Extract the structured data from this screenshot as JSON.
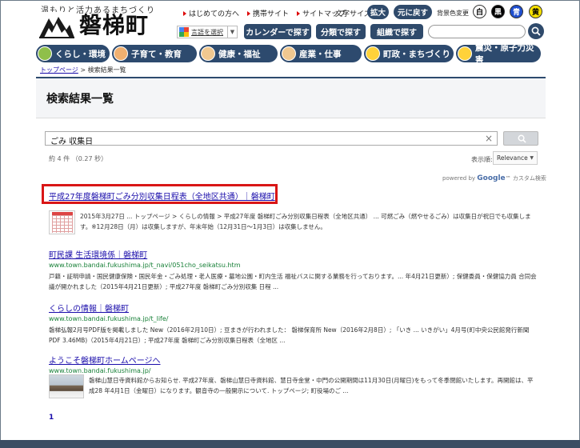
{
  "header": {
    "tagline": "温もりと活力あるまちづくり",
    "site_name": "磐梯町",
    "top_links": [
      "はじめての方へ",
      "携帯サイト",
      "サイトマップ"
    ],
    "font_size_label": "文字サイズ",
    "enlarge_label": "拡大",
    "reset_label": "元に戻す",
    "bg_color_label": "背景色変更",
    "color_buttons": [
      {
        "label": "白",
        "bg": "#ffffff",
        "fg": "#000000"
      },
      {
        "label": "黒",
        "bg": "#000000",
        "fg": "#ffffff"
      },
      {
        "label": "青",
        "bg": "#1f4fd0",
        "fg": "#ffffff"
      },
      {
        "label": "黄",
        "bg": "#f6e000",
        "fg": "#000000"
      }
    ],
    "translate_label": "言語を選択",
    "nav_buttons": [
      "カレンダーで探す",
      "分類で探す",
      "組織で探す"
    ]
  },
  "categories": [
    "くらし・環境",
    "子育て・教育",
    "健康・福祉",
    "産業・仕事",
    "町政・まちづくり",
    "震災・原子力災害"
  ],
  "breadcrumb": {
    "home": "トップページ",
    "separator": " > ",
    "current": "検索結果一覧"
  },
  "page_title": "検索結果一覧",
  "search": {
    "query": "ごみ  収集日",
    "clear": "×"
  },
  "stats": "約 4 件 （0.27 秒）",
  "sort": {
    "label": "表示順:",
    "value": "Relevance"
  },
  "powered_by": {
    "prefix": "powered by",
    "brand": "Google",
    "suffix": "™ カスタム検索"
  },
  "results": [
    {
      "title": "平成27年度磐梯町ごみ分別収集日程表（全地区共通）｜磐梯町",
      "url": "",
      "snippet": "2015年3月27日 ... トップページ > くらしの情報 > 平成27年度 磐梯町ごみ分別収集日程表（全地区共通） ... 可燃ごみ（燃やせるごみ）は収集日が祝日でも収集します。※12月28日（月）は収集しますが、年末年始（12月31日～1月3日）は収集しません。"
    },
    {
      "title": "町民課 生活環境係｜磐梯町",
      "url": "www.town.bandai.fukushima.jp/t_navi/051cho_seikatsu.htm",
      "snippet": "戸籍・証明申請・国民健康保険・国民年金・ごみ処理・老人医療・墓地公園・町内生活 福祉バスに関する業務を行っております。... 年4月21日更新）; 保健委員・保健協力員 合同会議が開かれました（2015年4月21日更新）; 平成27年度 磐梯町ごみ分別収集 日程 ..."
    },
    {
      "title": "くらしの情報｜磐梯町",
      "url": "www.town.bandai.fukushima.jp/t_life/",
      "snippet": "磐梯弘報2月号PDF版を掲載しました New（2016年2月10日）; 豆まきが行われました： 磐梯保育所 New（2016年2月8日）; 「いき ... いきがい」4月号(町中央公民館発行新聞 PDF 3.46MB)（2015年4月21日）; 平成27年度 磐梯町ごみ分別収集日程表（全地区 ..."
    },
    {
      "title": "ようこそ磐梯町ホームページへ",
      "url": "www.town.bandai.fukushima.jp/",
      "snippet": "磐梯山慧日寺資料館からお知らせ. 平成27年度、磐梯山慧日寺資料館、慧日寺金堂・中門の公開期間は11月30日(月曜日)をもって冬季閉館いたします。再開館は、平成28 年4月1日（金曜日）になります。観音寺の一般開示について. トップページ; 町役場のご ..."
    }
  ],
  "pager": "1"
}
